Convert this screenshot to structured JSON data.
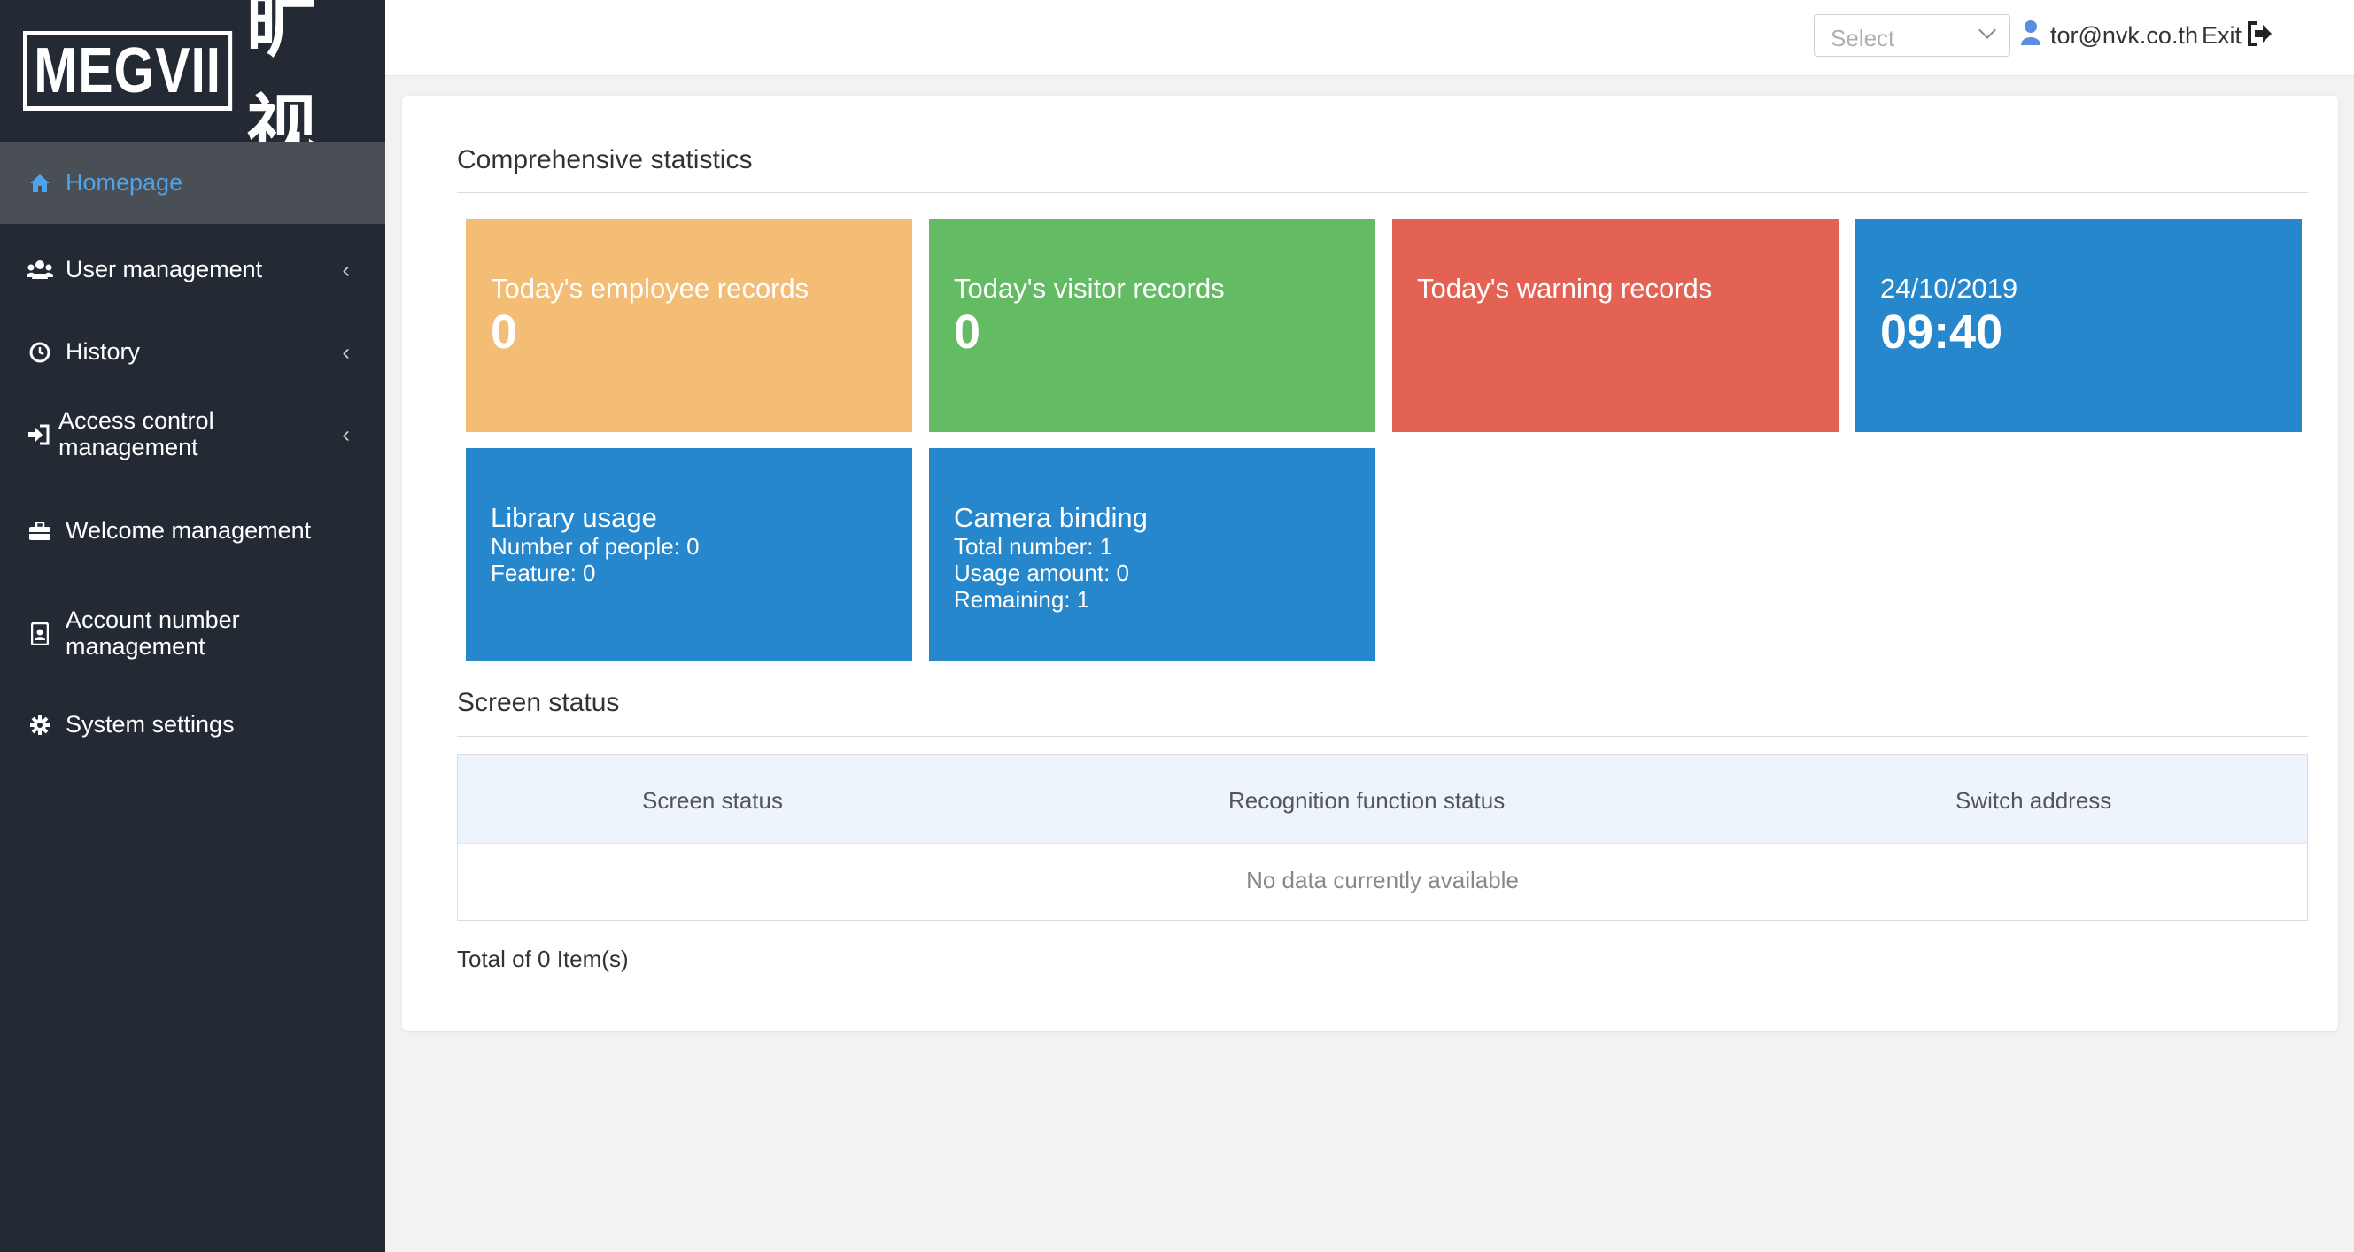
{
  "brand": {
    "logo_text": "MEGVII",
    "logo_cn": "旷视"
  },
  "sidebar": {
    "items": [
      {
        "label": "Homepage",
        "icon": "home-icon",
        "active": true
      },
      {
        "label": "User management",
        "icon": "users-icon"
      },
      {
        "label": "History",
        "icon": "clock-icon"
      },
      {
        "label": "Access control management",
        "icon": "sign-in-icon"
      },
      {
        "label": "Welcome management",
        "icon": "briefcase-icon"
      },
      {
        "label": "Account number management",
        "icon": "id-badge-icon"
      },
      {
        "label": "System settings",
        "icon": "gear-icon"
      }
    ]
  },
  "header": {
    "select_placeholder": "Select",
    "user_email": "tor@nvk.co.th",
    "exit_label": "Exit"
  },
  "stats": {
    "title": "Comprehensive statistics",
    "employee": {
      "title": "Today's employee records",
      "value": "0",
      "color": "#f3bd76"
    },
    "visitor": {
      "title": "Today's visitor records",
      "value": "0",
      "color": "#63bb63"
    },
    "warning": {
      "title": "Today's warning records",
      "color": "#e36254"
    },
    "datetime": {
      "date": "24/10/2019",
      "time": "09:40",
      "color": "#2787cc"
    },
    "library": {
      "title": "Library usage",
      "people": "Number of people: 0",
      "feature": "Feature: 0",
      "color": "#2787cc"
    },
    "camera": {
      "title": "Camera binding",
      "total": "Total number: 1",
      "usage": "Usage amount: 0",
      "remaining": "Remaining: 1",
      "color": "#2787cc"
    }
  },
  "screen_status": {
    "title": "Screen status",
    "columns": [
      "Screen status",
      "Recognition function status",
      "Switch address"
    ],
    "empty_text": "No data currently available",
    "total_text": "Total of 0 Item(s)"
  }
}
